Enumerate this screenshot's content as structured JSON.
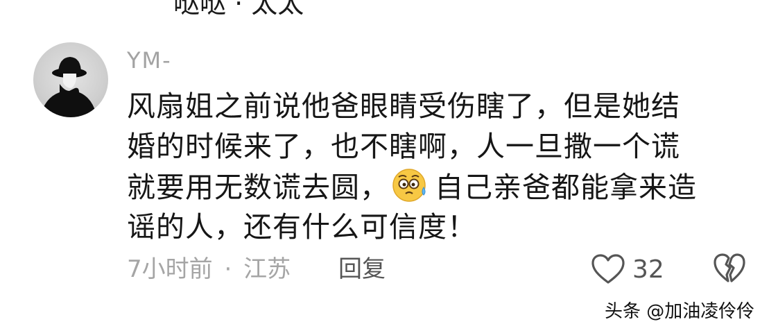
{
  "previous_comment": {
    "cut_off_text": "哒哒 · 太太"
  },
  "comment": {
    "username": "YM-",
    "body_lines": [
      "风扇姐之前说他爸眼睛受伤瞎了，但是她结",
      "婚的时候来了，也不瞎啊，人一旦撒一个谎",
      "就要用无数谎去圆，",
      "自己亲爸都能拿来造",
      "谣的人，还有什么可信度！"
    ],
    "emoji": "face-with-woozy-sweat-emoji",
    "time_ago": "7小时前",
    "separator": "·",
    "location": "江苏",
    "reply_label": "回复",
    "like_count": "32"
  },
  "icons": {
    "like": "heart-outline-icon",
    "dislike": "broken-heart-icon"
  },
  "watermark": "头条 @加油凌伶伶",
  "colors": {
    "body_text": "#161616",
    "muted_text": "#a3a3a3",
    "action_text": "#555555"
  }
}
